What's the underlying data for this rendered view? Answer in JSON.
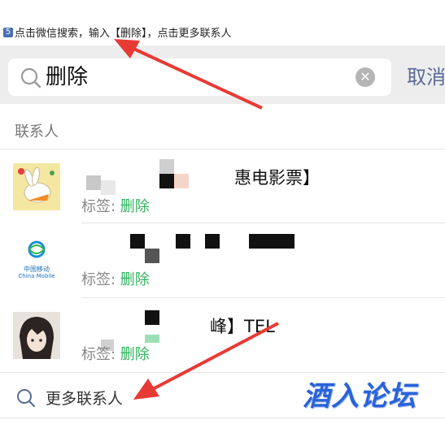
{
  "instruction": {
    "step": "5",
    "text": "点击微信搜索，输入【删除】，点击更多联系人"
  },
  "search": {
    "query": "删除",
    "cancel_label": "取消"
  },
  "section": {
    "title": "联系人"
  },
  "contacts": [
    {
      "name_visible": "惠电影票】",
      "tag_label": "标签: ",
      "tag_value": "删除"
    },
    {
      "name_visible": "",
      "tag_label": "标签: ",
      "tag_value": "删除",
      "avatar_text_cn": "中国移动",
      "avatar_text_en": "China Mobile"
    },
    {
      "name_visible": "峰】TEL",
      "tag_label": "标签: ",
      "tag_value": "删除"
    }
  ],
  "more_contacts": {
    "label": "更多联系人"
  },
  "watermark": {
    "text": "酒入论坛"
  },
  "colors": {
    "accent_link": "#576b95",
    "tag_green": "#2db55d",
    "arrow_red": "#e83a35"
  }
}
